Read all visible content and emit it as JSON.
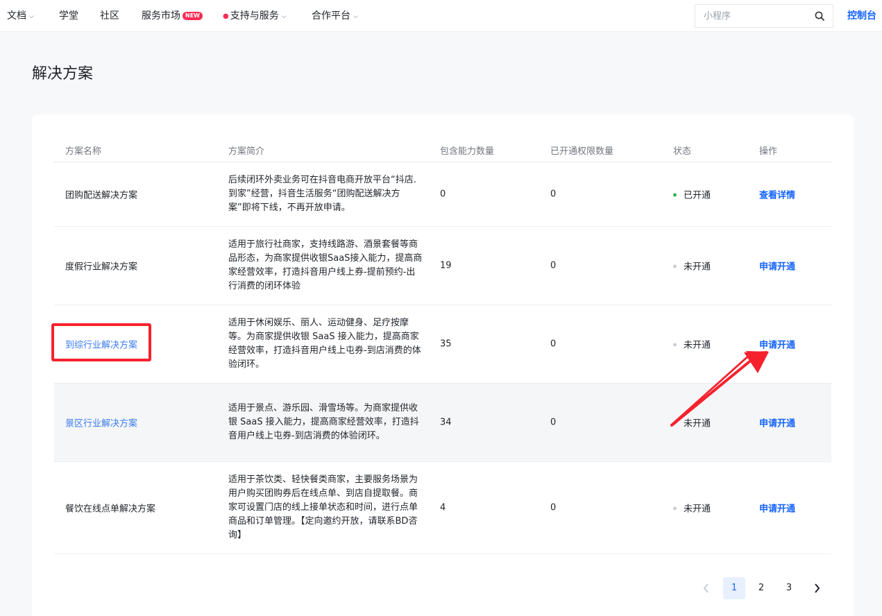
{
  "nav": {
    "docs": "文档",
    "academy": "学堂",
    "community": "社区",
    "market": "服务市场",
    "market_badge": "NEW",
    "support": "支持与服务",
    "partner": "合作平台",
    "console": "控制台"
  },
  "search": {
    "placeholder": "小程序"
  },
  "page": {
    "title": "解决方案"
  },
  "table": {
    "headers": [
      "方案名称",
      "方案简介",
      "包含能力数量",
      "已开通权限数量",
      "状态",
      "操作"
    ],
    "rows": [
      {
        "name": "团购配送解决方案",
        "desc": "后续闭环外卖业务可在抖音电商开放平台“抖店.到家”经营，抖音生活服务“团购配送解决方案”即将下线，不再开放申请。",
        "abilities": "0",
        "granted": "0",
        "status": "已开通",
        "action": "查看详情"
      },
      {
        "name": "度假行业解决方案",
        "desc": "适用于旅行社商家，支持线路游、酒景套餐等商品形态，为商家提供收银SaaS接入能力，提高商家经营效率，打造抖音用户线上券-提前预约-出行消费的闭环体验",
        "abilities": "19",
        "granted": "0",
        "status": "未开通",
        "action": "申请开通"
      },
      {
        "name": "到综行业解决方案",
        "desc": "适用于休闲娱乐、丽人、运动健身、足疗按摩等。为商家提供收银 SaaS 接入能力，提高商家经营效率，打造抖音用户线上屯券-到店消费的体验闭环。",
        "abilities": "35",
        "granted": "0",
        "status": "未开通",
        "action": "申请开通"
      },
      {
        "name": "景区行业解决方案",
        "desc": "适用于景点、游乐园、滑雪场等。为商家提供收银 SaaS 接入能力，提高商家经营效率，打造抖音用户线上屯券-到店消费的体验闭环。",
        "abilities": "34",
        "granted": "0",
        "status": "未开通",
        "action": "申请开通"
      },
      {
        "name": "餐饮在线点单解决方案",
        "desc": "适用于茶饮类、轻快餐类商家，主要服务场景为用户购买团购券后在线点单、到店自提取餐。商家可设置门店的线上接单状态和时间，进行点单商品和订单管理。【定向邀约开放，请联系BD咨询】",
        "abilities": "4",
        "granted": "0",
        "status": "未开通",
        "action": "申请开通"
      }
    ]
  },
  "pagination": {
    "pages": [
      "1",
      "2",
      "3"
    ],
    "current": "1"
  },
  "colors": {
    "accent": "#1664ff",
    "link": "#3a7cf0",
    "active_status": "#32b454",
    "annotation": "#f5222d"
  }
}
